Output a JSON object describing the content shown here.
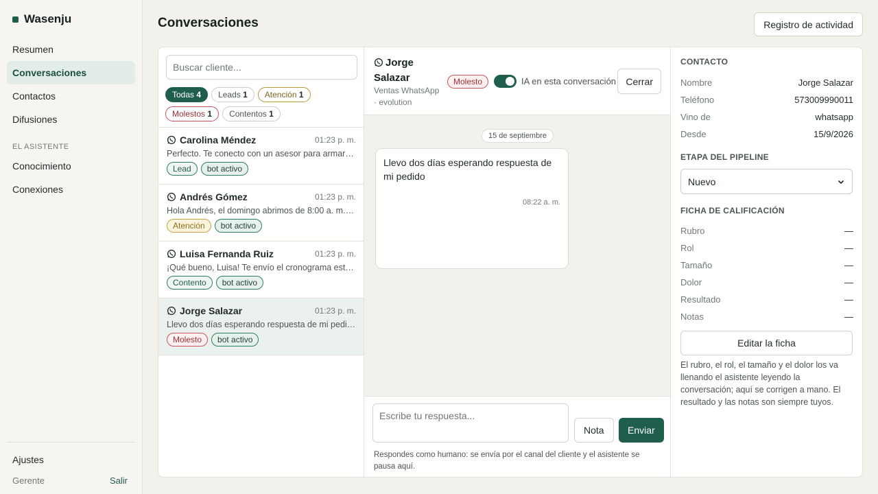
{
  "brand": {
    "name": "Wasenju"
  },
  "nav": {
    "items": [
      "Resumen",
      "Conversaciones",
      "Contactos",
      "Difusiones"
    ],
    "section": "EL ASISTENTE",
    "assistant_items": [
      "Conocimiento",
      "Conexiones"
    ],
    "settings": "Ajustes",
    "role": "Gerente",
    "logout": "Salir"
  },
  "header": {
    "title": "Conversaciones",
    "activity_button": "Registro de actividad"
  },
  "list": {
    "search_placeholder": "Buscar cliente...",
    "filters": [
      {
        "label": "Todas",
        "count": "4"
      },
      {
        "label": "Leads",
        "count": "1"
      },
      {
        "label": "Atención",
        "count": "1"
      },
      {
        "label": "Molestos",
        "count": "1"
      },
      {
        "label": "Contentos",
        "count": "1"
      }
    ],
    "conversations": [
      {
        "name": "Carolina Méndez",
        "time": "01:23 p. m.",
        "snippet": "Perfecto. Te conecto con un asesor para armar e…",
        "tags": [
          "Lead",
          "bot activo"
        ]
      },
      {
        "name": "Andrés Gómez",
        "time": "01:23 p. m.",
        "snippet": "Hola Andrés, el domingo abrimos de 8:00 a. m. …",
        "tags": [
          "Atención",
          "bot activo"
        ]
      },
      {
        "name": "Luisa Fernanda Ruiz",
        "time": "01:23 p. m.",
        "snippet": "¡Qué bueno, Luisa! Te envío el cronograma esta …",
        "tags": [
          "Contento",
          "bot activo"
        ]
      },
      {
        "name": "Jorge Salazar",
        "time": "01:23 p. m.",
        "snippet": "Llevo dos días esperando respuesta de mi pedido",
        "tags": [
          "Molesto",
          "bot activo"
        ]
      }
    ]
  },
  "chat": {
    "contact_name": "Jorge Salazar",
    "channel": "Ventas WhatsApp · evolution",
    "mood": "Molesto",
    "ai_label": "IA en esta conversación",
    "ai_enabled": true,
    "close_button": "Cerrar",
    "date": "15 de septiembre",
    "message": {
      "text": "Llevo dos días esperando respuesta de mi pedido",
      "time": "08:22 a. m."
    },
    "reply_placeholder": "Escribe tu respuesta...",
    "note_button": "Nota",
    "send_button": "Enviar",
    "composer_note": "Respondes como humano: se envía por el canal del cliente y el asistente se pausa aquí."
  },
  "contact": {
    "title": "CONTACTO",
    "fields": [
      {
        "label": "Nombre",
        "value": "Jorge Salazar"
      },
      {
        "label": "Teléfono",
        "value": "573009990011"
      },
      {
        "label": "Vino de",
        "value": "whatsapp"
      },
      {
        "label": "Desde",
        "value": "15/9/2026"
      }
    ],
    "pipeline_title": "ETAPA DEL PIPELINE",
    "pipeline_value": "Nuevo",
    "sheet_title": "FICHA DE CALIFICACIÓN",
    "sheet_fields": [
      {
        "label": "Rubro",
        "value": "—"
      },
      {
        "label": "Rol",
        "value": "—"
      },
      {
        "label": "Tamaño",
        "value": "—"
      },
      {
        "label": "Dolor",
        "value": "—"
      },
      {
        "label": "Resultado",
        "value": "—"
      },
      {
        "label": "Notas",
        "value": "—"
      }
    ],
    "edit_button": "Editar la ficha",
    "help_text": "El rubro, el rol, el tamaño y el dolor los va llenando el asistente leyendo la conversación; aquí se corrigen a mano. El resultado y las notas son siempre tuyos."
  }
}
